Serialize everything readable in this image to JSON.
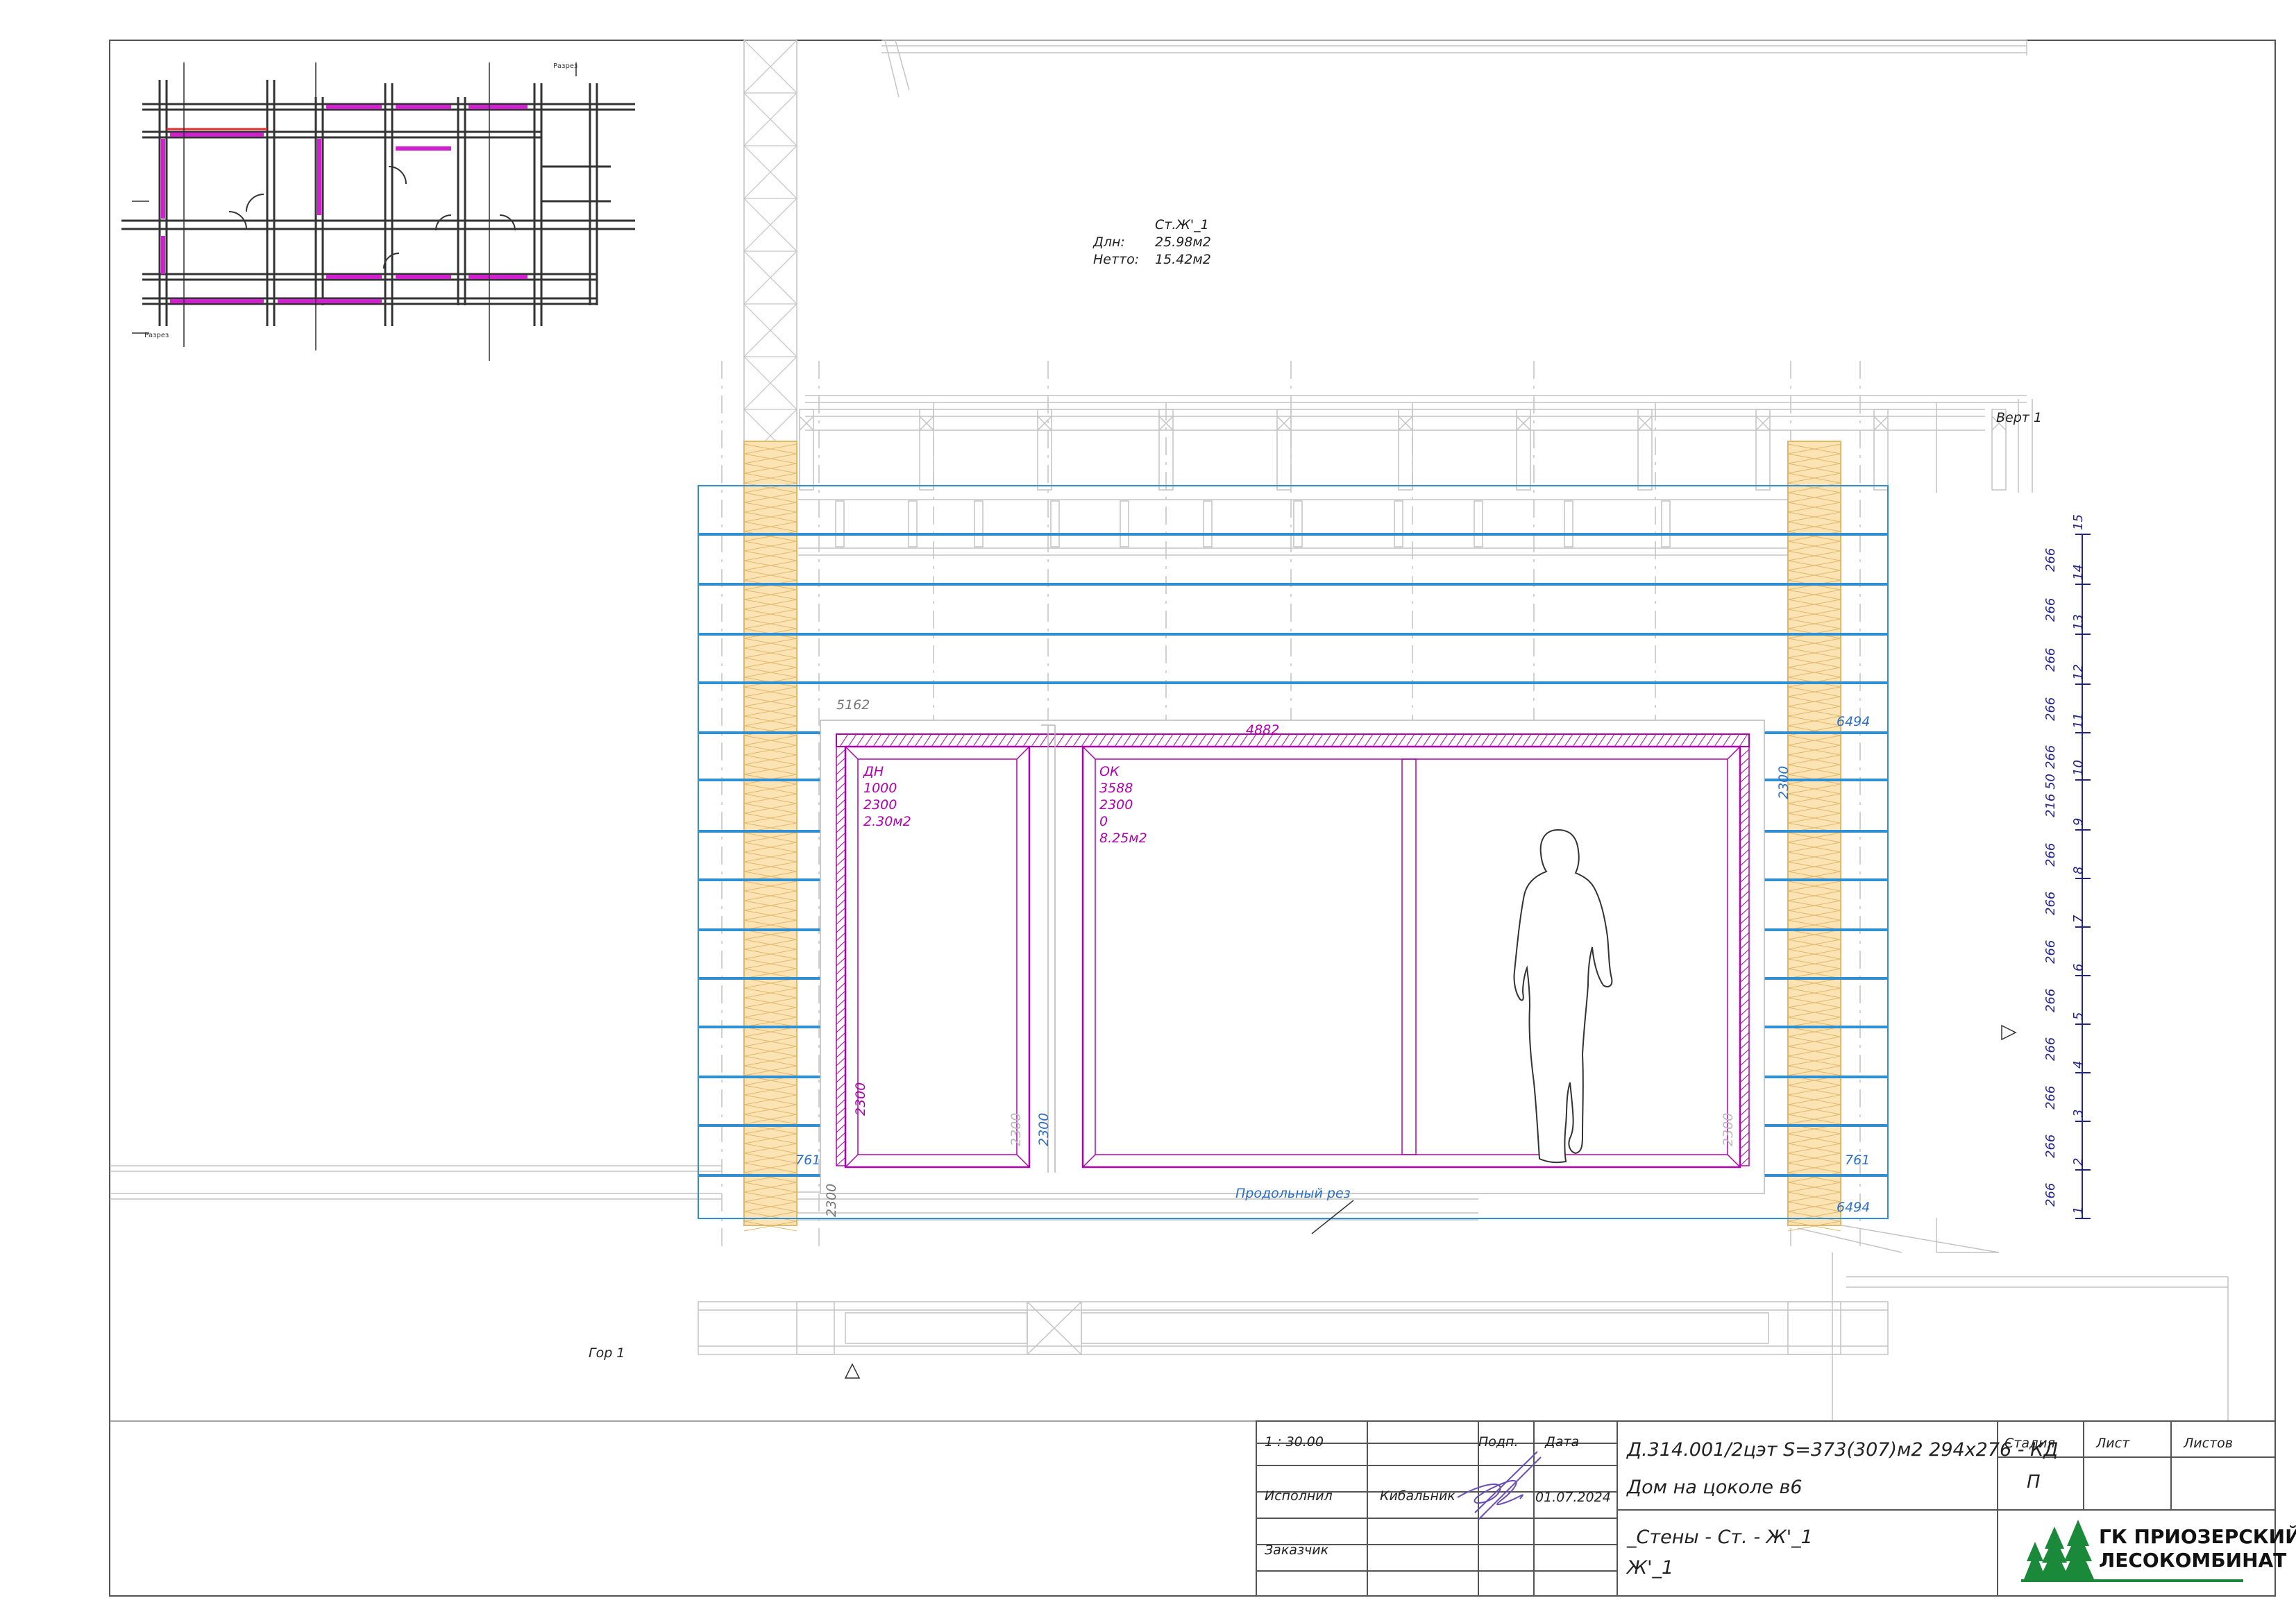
{
  "wall_info": {
    "name": "Ст.Ж'_1",
    "gross_label": "Длн:",
    "gross_value": "25.98м2",
    "net_label": "Нетто:",
    "net_value": "15.42м2"
  },
  "section_labels": {
    "vertical": "Верт 1",
    "horizontal": "Гор 1",
    "longitudinal_cut": "Продольный рез"
  },
  "door": {
    "type": "ДН",
    "width": "1000",
    "height": "2300",
    "area": "2.30м2"
  },
  "window": {
    "type": "ОК",
    "width": "3588",
    "height": "2300",
    "sill": "0",
    "area": "8.25м2"
  },
  "dimensions": {
    "opening_total": "4882",
    "left_offset": "5162",
    "right_top": "6494",
    "right_bottom": "6494",
    "left_761": "761",
    "right_761": "761",
    "h_2300": "2300"
  },
  "course_heights": [
    "266",
    "266",
    "266",
    "266",
    "266",
    "266",
    "266",
    "266",
    "216 50",
    "266",
    "266",
    "266",
    "266",
    "266"
  ],
  "course_numbers": [
    "1",
    "2",
    "3",
    "4",
    "5",
    "6",
    "7",
    "8",
    "9",
    "10",
    "11",
    "12",
    "13",
    "14",
    "15"
  ],
  "title_block": {
    "scale": "1 : 30.00",
    "sign_label": "Подп.",
    "date_label": "Дата",
    "performer_label": "Исполнил",
    "performer_name": "Кибальник",
    "date_value": "01.07.2024",
    "customer_label": "Заказчик",
    "project_code": "Д.314.001/2цэт S=373(307)м2 294x276 - КД",
    "project_name": "Дом на цоколе в6",
    "sheet_title_1": "_Стены - Ст. - Ж'_1",
    "sheet_title_2": "Ж'_1",
    "stage_label": "Стадия",
    "stage_value": "П",
    "sheet_label": "Лист",
    "sheets_label": "Листов",
    "company_line1": "ГК ПРИОЗЕРСКИЙ",
    "company_line2": "ЛЕСОКОМБИНАТ"
  },
  "keyplan": {
    "section_label": "Разрез"
  },
  "colors": {
    "log_blue": "#2f8fd0",
    "dim_blue": "#2a6fc4",
    "opening_magenta": "#b000b0",
    "course_navy": "#23238c",
    "post_fill": "#fbe3b4",
    "post_edge": "#e2b76b",
    "grey": "#aaaaaa"
  }
}
